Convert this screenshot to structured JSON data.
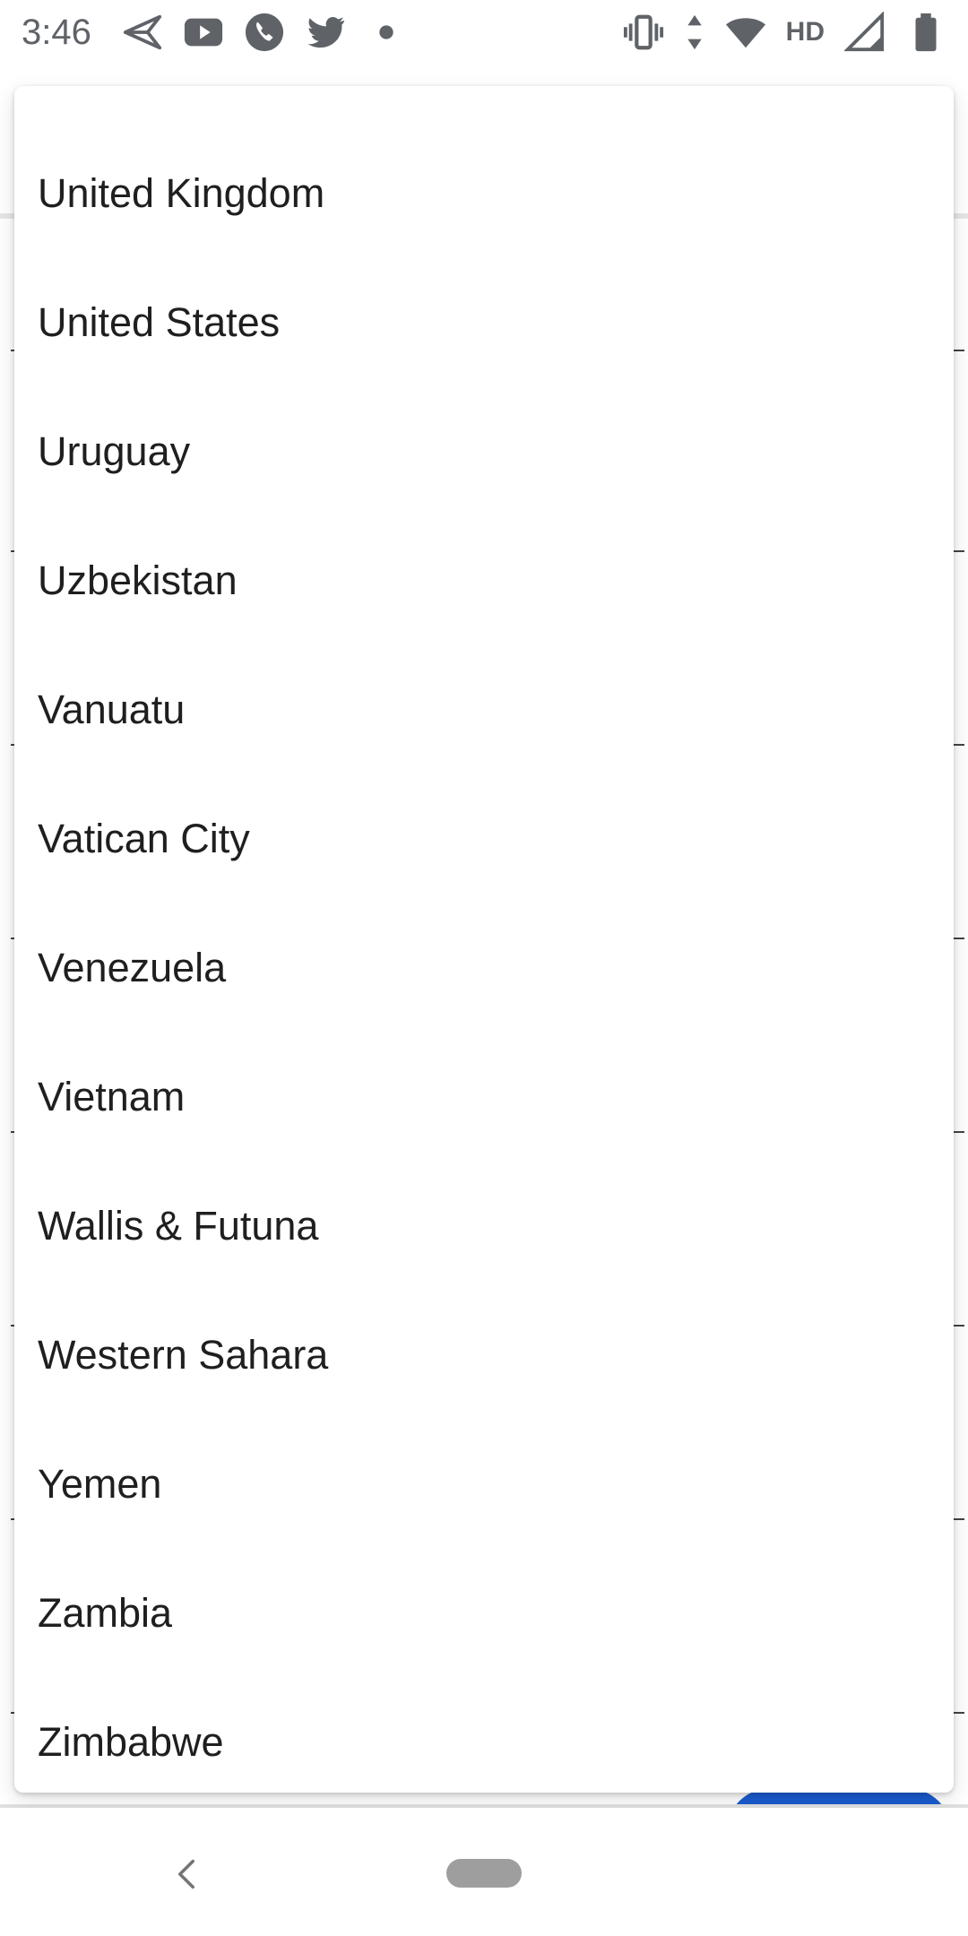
{
  "status_bar": {
    "time": "3:46",
    "hd_label": "HD",
    "left_icons": [
      "send-icon",
      "youtube-icon",
      "phone-icon",
      "twitter-icon",
      "dot-icon"
    ],
    "right_icons": [
      "vibrate-icon",
      "data-arrows-icon",
      "wifi-icon",
      "signal-icon",
      "battery-icon"
    ]
  },
  "dropdown": {
    "items": [
      "United Kingdom",
      "United States",
      "Uruguay",
      "Uzbekistan",
      "Vanuatu",
      "Vatican City",
      "Venezuela",
      "Vietnam",
      "Wallis & Futuna",
      "Western Sahara",
      "Yemen",
      "Zambia",
      "Zimbabwe"
    ]
  },
  "colors": {
    "accent": "#1a5cd1",
    "text": "#1f1f1f",
    "status_grey": "#5f6368"
  },
  "nav_bar": {
    "icons": [
      "back-icon",
      "home-pill-icon"
    ]
  }
}
